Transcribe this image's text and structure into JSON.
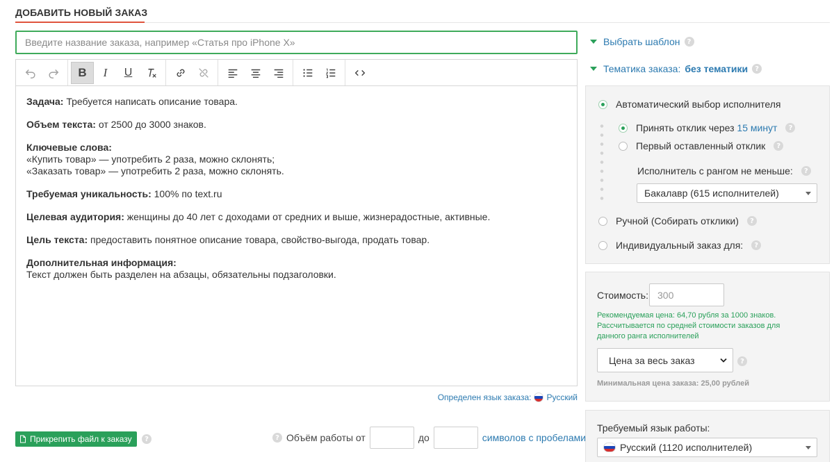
{
  "page": {
    "title": "ДОБАВИТЬ НОВЫЙ ЗАКАЗ"
  },
  "order_name": {
    "placeholder": "Введите название заказа, например «Статья про iPhone X»",
    "value": ""
  },
  "toolbar": {
    "buttons": [
      {
        "name": "undo",
        "icon": "undo-icon"
      },
      {
        "name": "redo",
        "icon": "redo-icon"
      },
      {
        "name": "bold",
        "icon": "bold-icon",
        "label": "B",
        "active": true
      },
      {
        "name": "italic",
        "icon": "italic-icon",
        "label": "I"
      },
      {
        "name": "underline",
        "icon": "underline-icon",
        "label": "U"
      },
      {
        "name": "clear-format",
        "icon": "clear-format-icon",
        "label": "Tx"
      },
      {
        "name": "link",
        "icon": "link-icon"
      },
      {
        "name": "unlink",
        "icon": "unlink-icon"
      },
      {
        "name": "align-left",
        "icon": "align-left-icon"
      },
      {
        "name": "align-center",
        "icon": "align-center-icon"
      },
      {
        "name": "align-right",
        "icon": "align-right-icon"
      },
      {
        "name": "bullet-list",
        "icon": "bullet-list-icon"
      },
      {
        "name": "numbered-list",
        "icon": "numbered-list-icon"
      },
      {
        "name": "source",
        "icon": "code-icon",
        "label": "<>"
      }
    ]
  },
  "content": {
    "task_label": "Задача:",
    "task_text": " Требуется написать описание товара.",
    "volume_label": "Объем текста:",
    "volume_text": " от 2500 до 3000 знаков.",
    "keywords_label": "Ключевые слова:",
    "keyword_1": "«Купить товар» — употребить 2 раза, можно склонять;",
    "keyword_2": "«Заказать товар» — употребить 2 раза, можно склонять.",
    "uniq_label": "Требуемая уникальность:",
    "uniq_text": " 100% по text.ru",
    "audience_label": "Целевая аудитория:",
    "audience_text": " женщины до 40 лет с доходами от средних и выше, жизнерадостные, активные.",
    "goal_label": "Цель текста:",
    "goal_text": " предоставить понятное описание товара, свойство-выгода, продать товар.",
    "extra_label": "Дополнительная информация:",
    "extra_text": "Текст должен быть разделен на абзацы, обязательны подзаголовки."
  },
  "language_detect": {
    "label": "Определен язык заказа:",
    "value": "Русский"
  },
  "attach": {
    "label": "Прикрепить файл к заказу"
  },
  "volume": {
    "prefix": "Объём работы от",
    "mid": "до",
    "suffix": "символов с пробелами",
    "from": "",
    "to": ""
  },
  "sidebar": {
    "template_label": "Выбрать шаблон",
    "topic_label": "Тематика заказа:",
    "topic_value": "без тематики",
    "auto_select": "Автоматический выбор исполнителя",
    "accept_response_prefix": "Принять отклик через",
    "accept_response_time": "15 минут",
    "first_response": "Первый оставленный отклик",
    "rank_label": "Исполнитель с рангом не меньше:",
    "rank_value": "Бакалавр (615 исполнителей)",
    "manual": "Ручной (Собирать отклики)",
    "individual": "Индивидуальный заказ для:",
    "cost_label": "Стоимость:",
    "cost_placeholder": "300",
    "rec_line1": "Рекомендуемая цена: 64,70 рубля за 1000 знаков.",
    "rec_line2": "Рассчитывается по средней стоимости заказов для данного ранга исполнителей",
    "price_type": "Цена за весь заказ",
    "min_price": "Минимальная цена заказа: 25,00 рублей",
    "work_lang_label": "Требуемый язык работы:",
    "work_lang_value": "Русский (1120 исполнителей)"
  },
  "colors": {
    "accent_green": "#2aa05a",
    "link_blue": "#2c7ab0",
    "title_underline": "#e0533c"
  }
}
